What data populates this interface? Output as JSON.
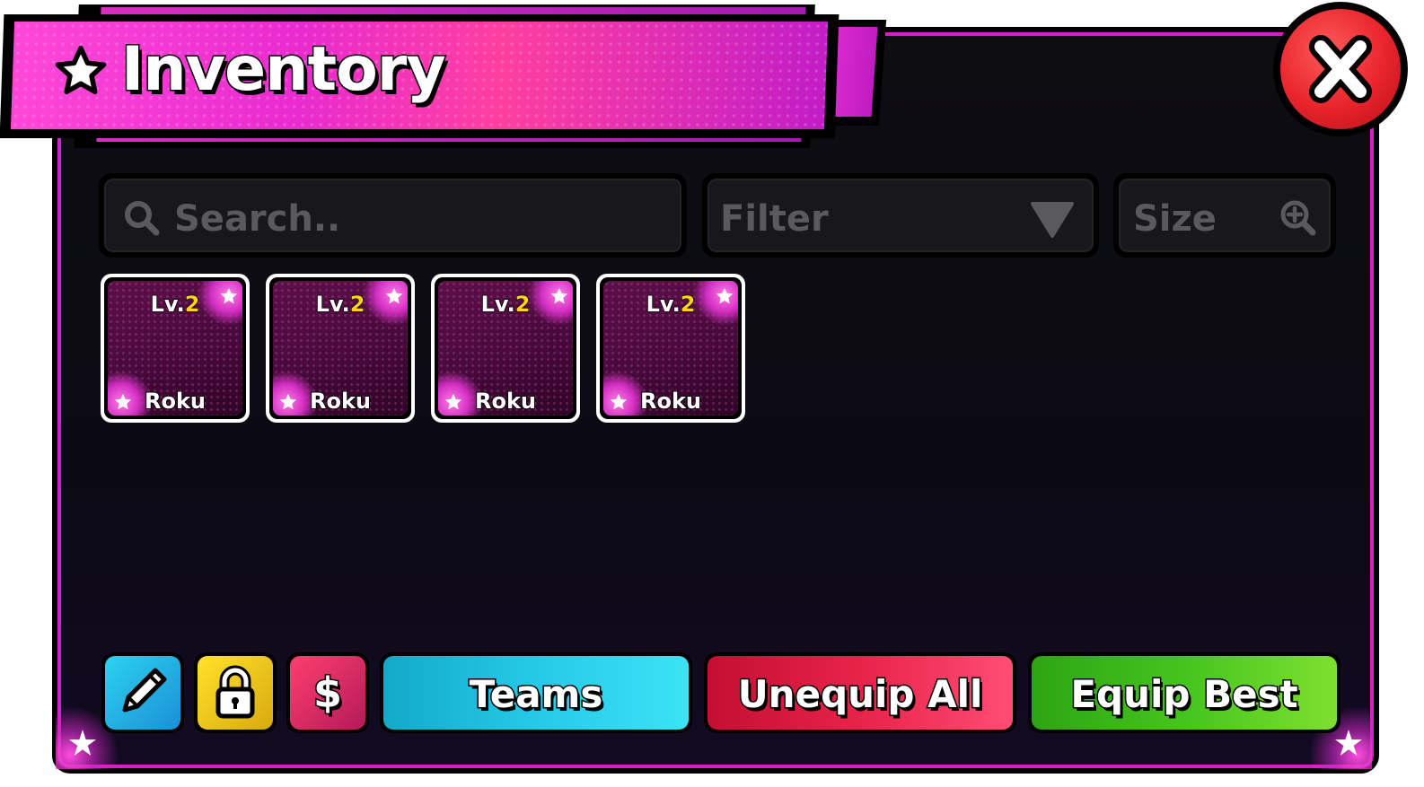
{
  "title": "Inventory",
  "close": {
    "glyph": "✕"
  },
  "toolbar": {
    "search_placeholder": "Search..",
    "filter_label": "Filter",
    "size_label": "Size"
  },
  "items": [
    {
      "level_prefix": "Lv.",
      "level": "2",
      "name": "Roku"
    },
    {
      "level_prefix": "Lv.",
      "level": "2",
      "name": "Roku"
    },
    {
      "level_prefix": "Lv.",
      "level": "2",
      "name": "Roku"
    },
    {
      "level_prefix": "Lv.",
      "level": "2",
      "name": "Roku"
    }
  ],
  "bottom_bar": {
    "edit_icon": "pencil-icon",
    "lock_icon": "lock-icon",
    "sell_icon": "dollar-icon",
    "sell_glyph": "$",
    "teams_label": "Teams",
    "unequip_label": "Unequip All",
    "equip_label": "Equip Best"
  },
  "colors": {
    "accent": "#d61fc8",
    "close": "#e8232b",
    "level_number": "#ffd21a",
    "teams": "#2ec8e8",
    "unequip": "#e8234a",
    "equip": "#45c41e"
  }
}
